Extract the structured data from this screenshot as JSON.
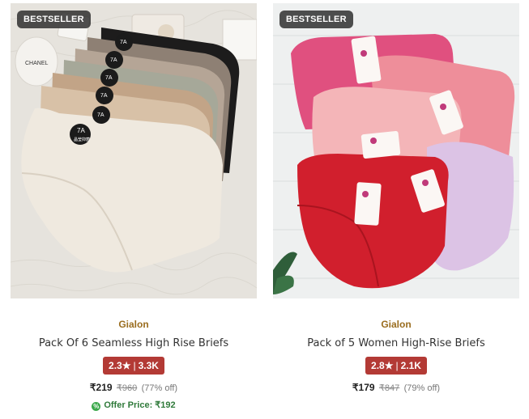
{
  "products": [
    {
      "badge": "BESTSELLER",
      "brand": "Gialon",
      "title": "Pack Of 6 Seamless High Rise Briefs",
      "rating": "2.3",
      "star": "★",
      "reviews": "3.3K",
      "price": "₹219",
      "mrp": "₹960",
      "discount": "(77% off)",
      "offer": "Offer Price: ₹192",
      "image_text": {
        "box": "CHANEL",
        "tag": "7A",
        "tag_sub": "晶莹抑菌"
      }
    },
    {
      "badge": "BESTSELLER",
      "brand": "Gialon",
      "title": "Pack of 5 Women High-Rise Briefs",
      "rating": "2.8",
      "star": "★",
      "reviews": "2.1K",
      "price": "₹179",
      "mrp": "₹847",
      "discount": "(79% off)"
    }
  ],
  "colors": {
    "brand": "#9a6d1f",
    "rating_bg": "#b33a35",
    "offer_green": "#2f7a3a"
  }
}
